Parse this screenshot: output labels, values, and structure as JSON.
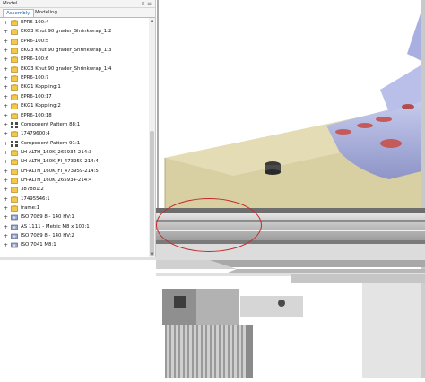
{
  "panel": {
    "title": "Model",
    "controls": [
      "×",
      "≡"
    ],
    "tabs": [
      {
        "label": "Assembly",
        "active": true
      },
      {
        "label": "Modeling",
        "active": false
      }
    ],
    "tree": [
      {
        "label": "EPR6-100:4",
        "icon": "part-icon"
      },
      {
        "label": "EKG3 Knut 90 grader_Shrinkwrap_1:2",
        "icon": "part-icon"
      },
      {
        "label": "EPR6-100:5",
        "icon": "part-icon"
      },
      {
        "label": "EKG3 Knut 90 grader_Shrinkwrap_1:3",
        "icon": "part-icon"
      },
      {
        "label": "EPR6-100:6",
        "icon": "part-icon"
      },
      {
        "label": "EKG3 Knut 90 grader_Shrinkwrap_1:4",
        "icon": "part-icon"
      },
      {
        "label": "EPR6-100:7",
        "icon": "part-icon"
      },
      {
        "label": "EKG1 Koppling:1",
        "icon": "part-icon"
      },
      {
        "label": "EPR6-100:17",
        "icon": "part-icon"
      },
      {
        "label": "EKG1 Koppling:2",
        "icon": "part-icon"
      },
      {
        "label": "EPR6-100:18",
        "icon": "part-icon"
      },
      {
        "label": "Component Pattern 88:1",
        "icon": "pattern-icon"
      },
      {
        "label": "17479600:4",
        "icon": "part-icon"
      },
      {
        "label": "Component Pattern 91:1",
        "icon": "pattern-icon"
      },
      {
        "label": "LH-ALTH_160K_265934-214:3",
        "icon": "part-icon"
      },
      {
        "label": "LH-ALTH_160K_FI_473959-214:4",
        "icon": "part-icon"
      },
      {
        "label": "LH-ALTH_160K_FI_473959-214:5",
        "icon": "part-icon"
      },
      {
        "label": "LH-ALTH_160K_265934-214:4",
        "icon": "part-icon"
      },
      {
        "label": "387881:2",
        "icon": "part-icon"
      },
      {
        "label": "17495546:1",
        "icon": "part-icon"
      },
      {
        "label": "frame:1",
        "icon": "part-icon"
      },
      {
        "label": "ISO 7089 8 - 140 HV:1",
        "icon": "fastener-icon"
      },
      {
        "label": "AS 1111 - Metric M8 x 100:1",
        "icon": "fastener-icon"
      },
      {
        "label": "ISO 7089 8 - 140 HV:2",
        "icon": "fastener-icon"
      },
      {
        "label": "ISO 7041 M8:1",
        "icon": "fastener-icon"
      }
    ]
  },
  "colors": {
    "annotation": "#c52a2a",
    "plate": "#d8d0a3",
    "rail": "#c4c4c4",
    "component": "#aeb4e0"
  }
}
